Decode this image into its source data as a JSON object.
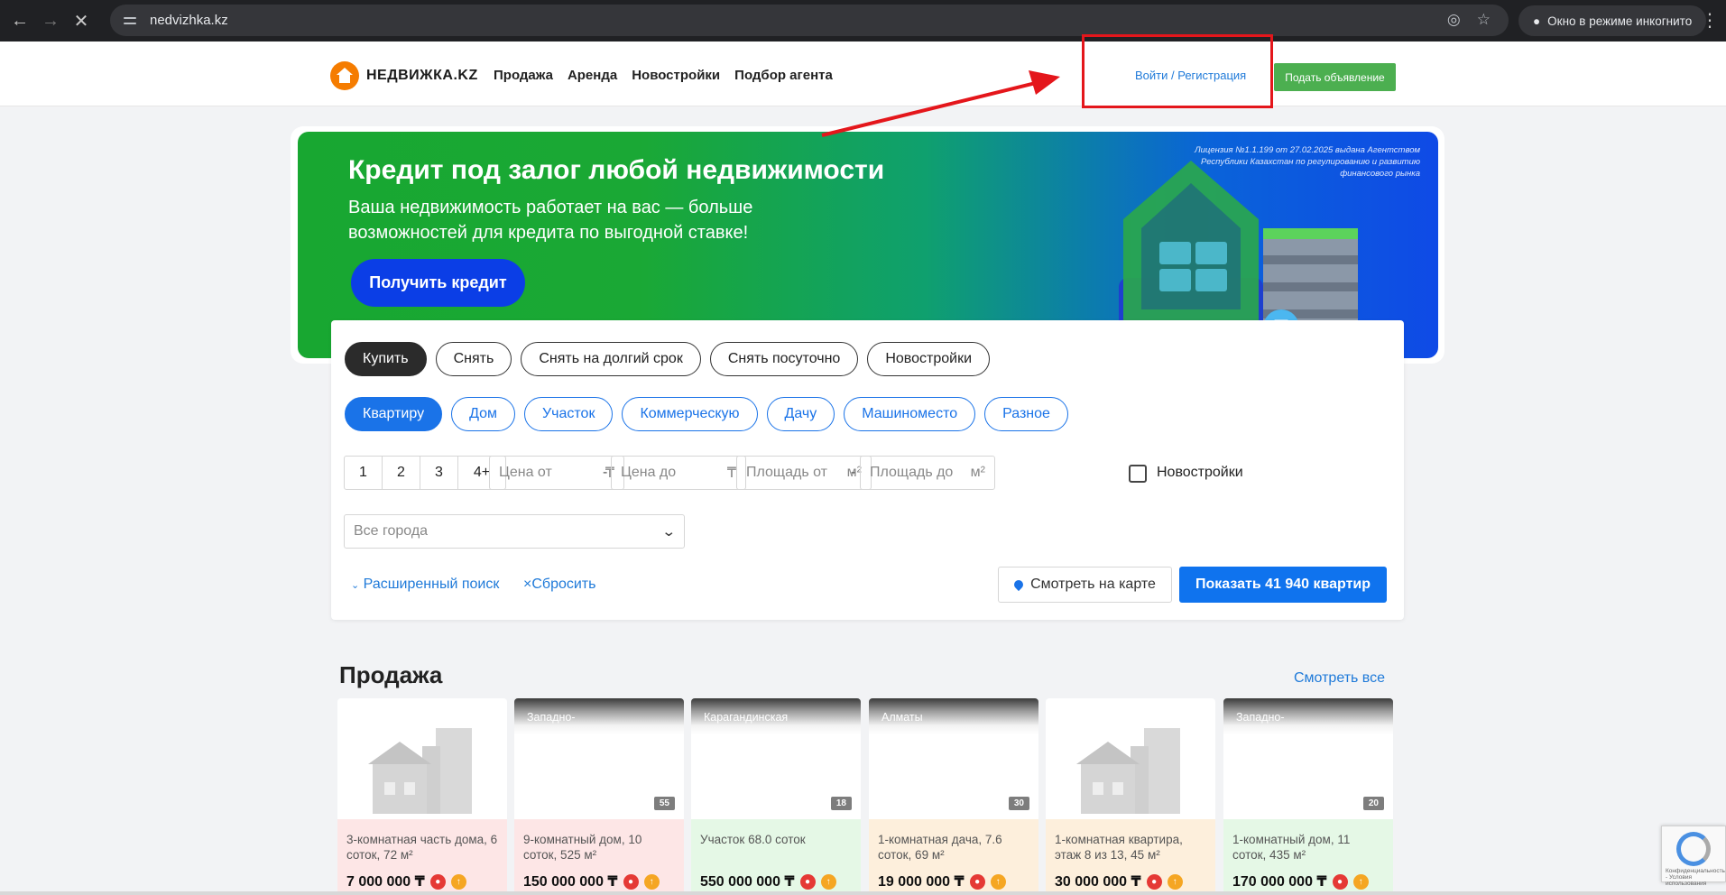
{
  "browser": {
    "url": "nedvizhka.kz",
    "incognito_label": "Окно в режиме инкогнито"
  },
  "header": {
    "logo_text": "НЕДВИЖКА.KZ",
    "nav": [
      "Продажа",
      "Аренда",
      "Новостройки",
      "Подбор агента"
    ],
    "login_label": "Войти / Регистрация",
    "post_ad_label": "Подать объявление"
  },
  "banner": {
    "title": "Кредит под залог любой недвижимости",
    "subtitle": "Ваша недвижимость работает на вас — больше возможностей для кредита по выгодной ставке!",
    "cta": "Получить кредит",
    "license": "Лицензия №1.1.199 от 27.02.2025 выдана Агентством Республики Казахстан по регулированию и развитию финансового рынка"
  },
  "search": {
    "deal_types": [
      "Купить",
      "Снять",
      "Снять на долгий срок",
      "Снять посуточно",
      "Новостройки"
    ],
    "property_types": [
      "Квартиру",
      "Дом",
      "Участок",
      "Коммерческую",
      "Дачу",
      "Машиноместо",
      "Разное"
    ],
    "rooms": [
      "1",
      "2",
      "3",
      "4+"
    ],
    "price_from": "Цена от",
    "price_to": "Цена до",
    "currency": "₸",
    "area_from": "Площадь от",
    "area_to": "Площадь до",
    "area_unit": "м²",
    "dash": "-",
    "new_buildings_label": "Новостройки",
    "city_placeholder": "Все города",
    "advanced_label": "Расширенный поиск",
    "reset_label": "Сбросить",
    "map_label": "Смотреть на карте",
    "show_label": "Показать 41 940 квартир"
  },
  "listings": {
    "title": "Продажа",
    "see_all": "Смотреть все",
    "cards": [
      {
        "region": "",
        "count": "",
        "desc": "3-комнатная часть дома, 6 соток, 72 м²",
        "price": "7 000 000 ₸",
        "bg": "#fde6e6"
      },
      {
        "region": "Западно-",
        "count": "55",
        "desc": "9-комнатный дом, 10 соток, 525 м²",
        "price": "150 000 000 ₸",
        "bg": "#fde6e6"
      },
      {
        "region": "Карагандинская",
        "count": "18",
        "desc": "Участок 68.0 соток",
        "price": "550 000 000 ₸",
        "bg": "#e5f8e6"
      },
      {
        "region": "Алматы",
        "count": "30",
        "desc": "1-комнатная дача, 7.6 соток, 69 м²",
        "price": "19 000 000 ₸",
        "bg": "#fdefdc"
      },
      {
        "region": "",
        "count": "",
        "desc": "1-комнатная квартира, этаж 8 из 13, 45 м²",
        "price": "30 000 000 ₸",
        "bg": "#fdefdc"
      },
      {
        "region": "Западно-",
        "count": "20",
        "desc": "1-комнатный дом, 11 соток, 435 м²",
        "price": "170 000 000 ₸",
        "bg": "#e5f8e6"
      }
    ]
  },
  "recaptcha": {
    "text": "Конфиденциальность - Условия использования"
  },
  "colors": {
    "accent_blue": "#0f73ee",
    "post_ad_green": "#4caf50",
    "annotation_red": "#e4161b"
  }
}
